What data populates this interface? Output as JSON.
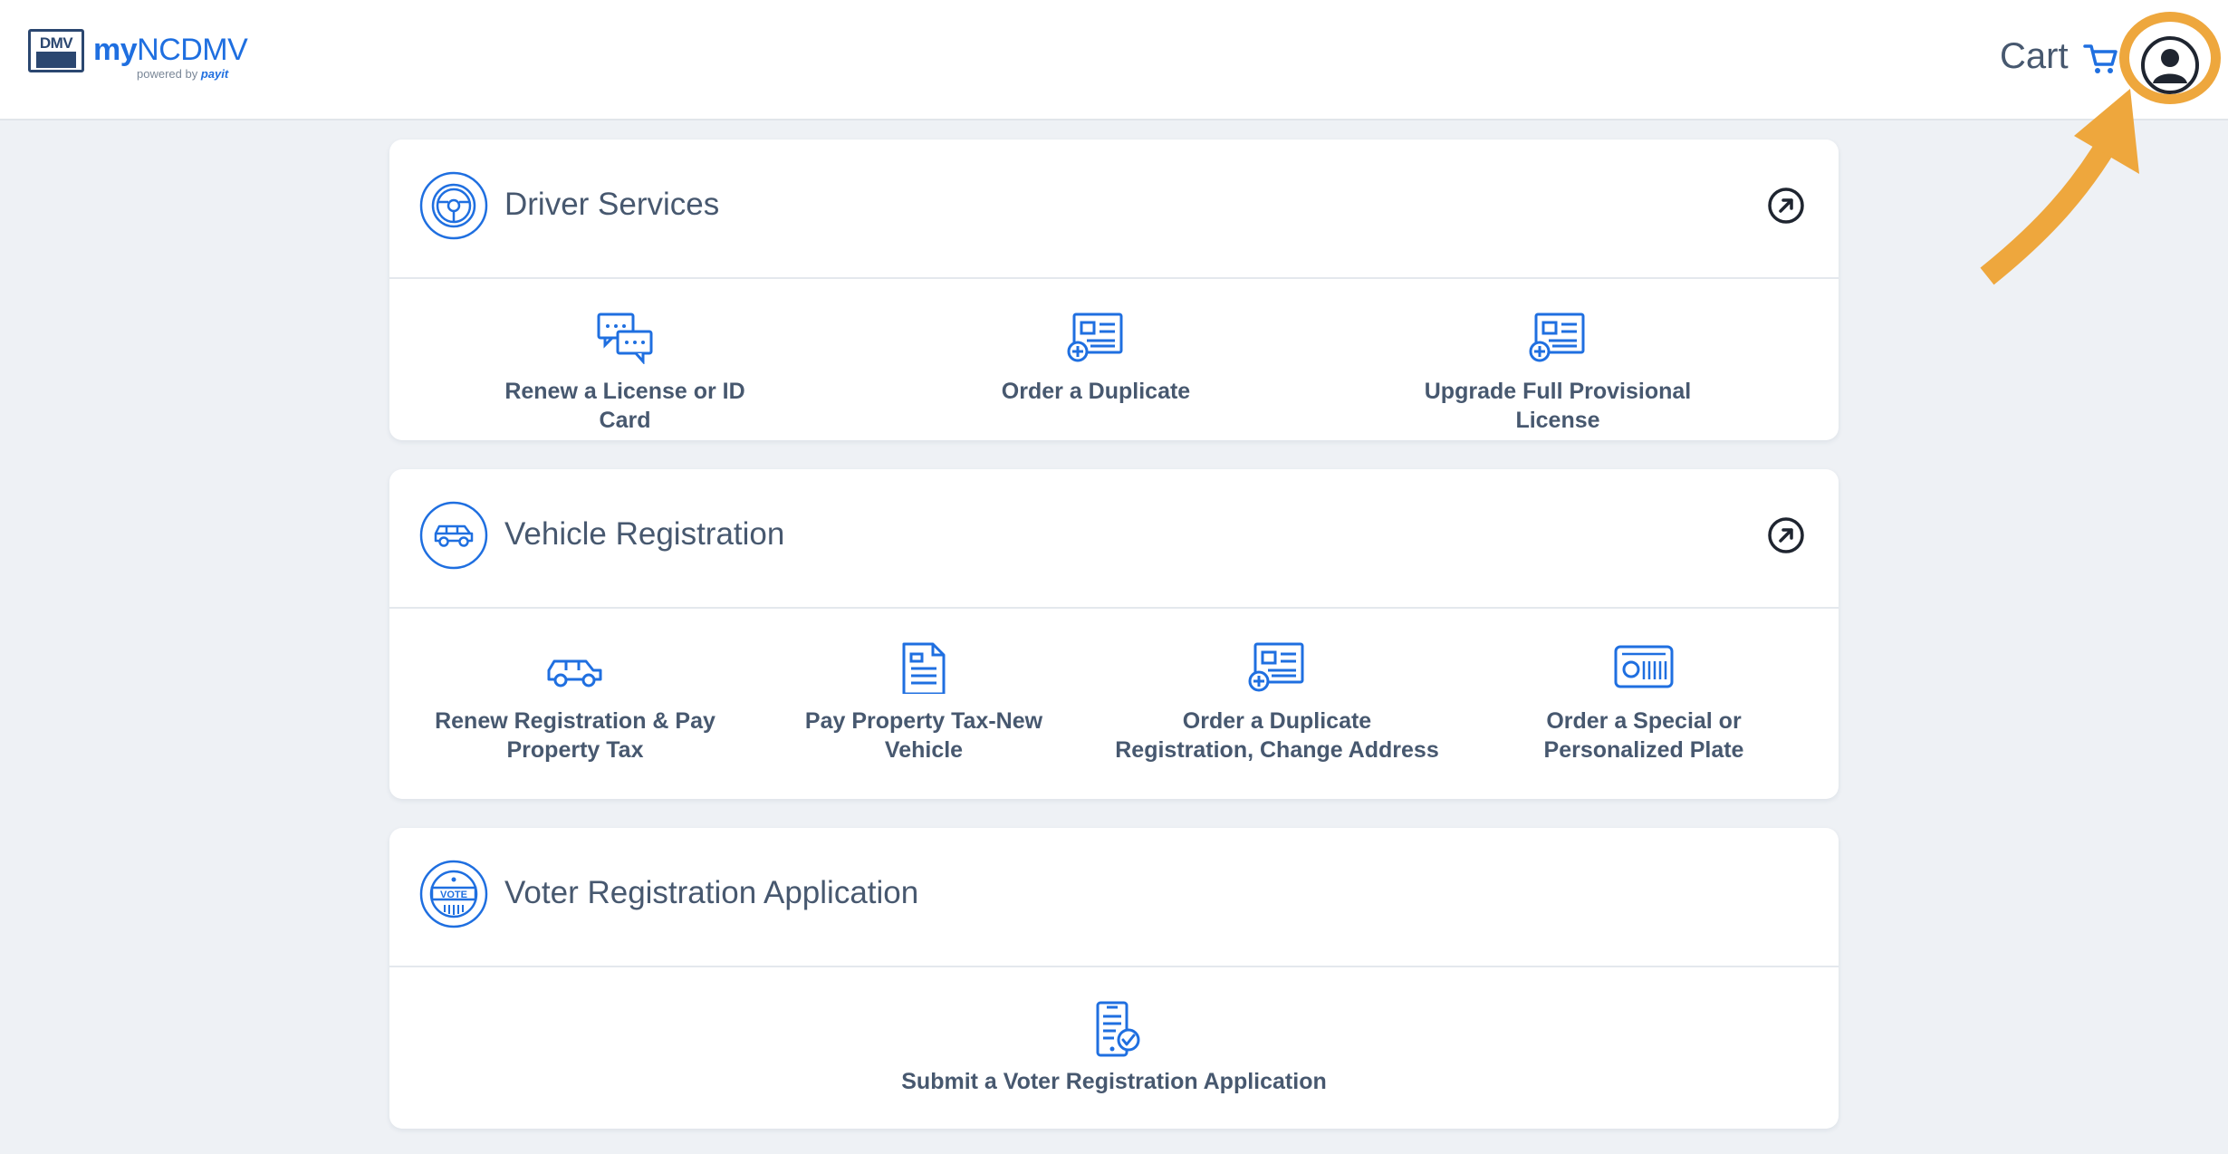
{
  "header": {
    "logo": {
      "box_text": "DMV",
      "brand_my": "my",
      "brand_rest": "NCDMV",
      "powered_prefix": "powered by",
      "powered_brand": "payit"
    },
    "cart_label": "Cart"
  },
  "sections": [
    {
      "title": "Driver Services",
      "services": [
        {
          "label": "Renew a License or ID Card",
          "icon": "chat-bubbles-icon"
        },
        {
          "label": "Order a Duplicate",
          "icon": "id-card-add-icon"
        },
        {
          "label": "Upgrade Full Provisional License",
          "icon": "id-card-add-icon"
        }
      ]
    },
    {
      "title": "Vehicle Registration",
      "services": [
        {
          "label_line1": "Renew Registration & Pay",
          "label_line2": "Property Tax",
          "icon": "car-icon"
        },
        {
          "label_line1": "Pay Property Tax-New Vehicle",
          "label_line2": "",
          "icon": "document-icon"
        },
        {
          "label_line1": "Order a Duplicate",
          "label_line2": "Registration, Change Address",
          "icon": "id-card-add-icon"
        },
        {
          "label_line1": "Order a Special or",
          "label_line2": "Personalized Plate",
          "icon": "license-plate-icon"
        }
      ]
    },
    {
      "title": "Voter Registration Application",
      "vote_badge": "VOTE",
      "services": [
        {
          "label": "Submit a Voter Registration Application",
          "icon": "phone-checklist-icon"
        }
      ]
    }
  ],
  "colors": {
    "accent": "#1f6fe0",
    "text": "#47586f",
    "highlight": "#eea73d",
    "background": "#eef1f5"
  }
}
